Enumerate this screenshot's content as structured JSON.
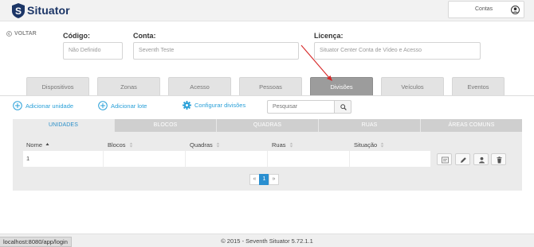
{
  "header": {
    "logo_text": "Situator",
    "logo_letter": "S",
    "account_label": "Contas"
  },
  "back": {
    "label": "VOLTAR"
  },
  "fields": {
    "codigo": {
      "label": "Código:",
      "value": "Não Definido"
    },
    "conta": {
      "label": "Conta:",
      "value": "Seventh Teste"
    },
    "licenca": {
      "label": "Licença:",
      "value": "Situator Center Conta de Vídeo e Acesso"
    }
  },
  "tabs": [
    {
      "label": "Dispositivos",
      "active": false
    },
    {
      "label": "Zonas",
      "active": false
    },
    {
      "label": "Acesso",
      "active": false
    },
    {
      "label": "Pessoas",
      "active": false
    },
    {
      "label": "Divisões",
      "active": true
    },
    {
      "label": "Veículos",
      "active": false
    },
    {
      "label": "Eventos",
      "active": false
    }
  ],
  "actions": {
    "add_unit": "Adicionar unidade",
    "add_batch": "Adicionar lote",
    "configure": "Configurar divisões",
    "search_placeholder": "Pesquisar"
  },
  "subtabs": [
    {
      "label": "UNIDADES",
      "active": true
    },
    {
      "label": "BLOCOS",
      "active": false
    },
    {
      "label": "QUADRAS",
      "active": false
    },
    {
      "label": "RUAS",
      "active": false
    },
    {
      "label": "ÁREAS COMUNS",
      "active": false
    }
  ],
  "table": {
    "columns": [
      "Nome",
      "Blocos",
      "Quadras",
      "Ruas",
      "Situação"
    ],
    "rows": [
      {
        "nome": "1",
        "blocos": "",
        "quadras": "",
        "ruas": "",
        "situacao": ""
      }
    ]
  },
  "pagination": {
    "prev": "«",
    "current": "1",
    "next": "»"
  },
  "footer": {
    "text": "© 2015 - Seventh Situator 5.72.1.1"
  },
  "status_url": "localhost:8080/app/login",
  "colors": {
    "brand": "#1b3566",
    "accent": "#2aa0d8",
    "active_tab": "#9c9c9c",
    "arrow": "#d62828"
  }
}
